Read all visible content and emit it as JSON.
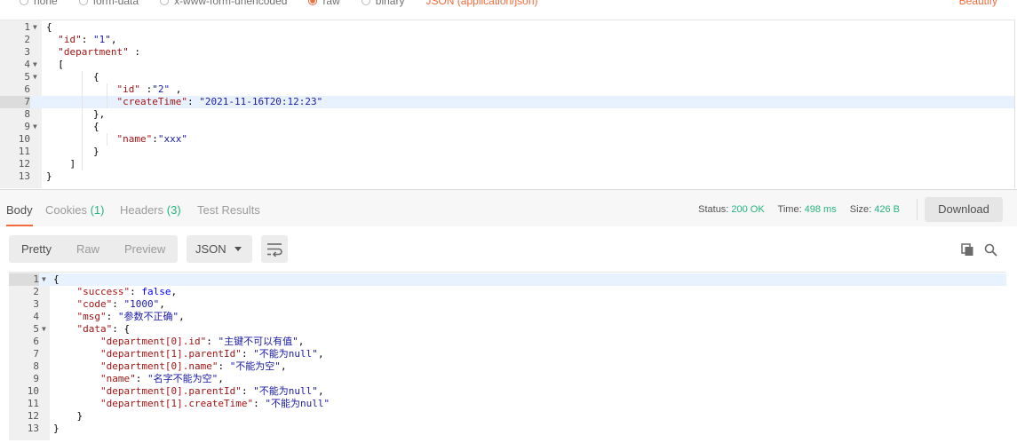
{
  "body_type_options": [
    {
      "label": "none",
      "selected": false
    },
    {
      "label": "form-data",
      "selected": false
    },
    {
      "label": "x-www-form-urlencoded",
      "selected": false
    },
    {
      "label": "raw",
      "selected": true
    },
    {
      "label": "binary",
      "selected": false
    }
  ],
  "raw_type_label": "JSON (application/json)",
  "beautify_label": "Beautify",
  "request_editor": {
    "active_line": 7,
    "lines": [
      {
        "n": "1",
        "fold": true,
        "text": "{"
      },
      {
        "n": "2",
        "fold": false,
        "text": "  \"id\": \"1\","
      },
      {
        "n": "3",
        "fold": false,
        "text": "  \"department\" :"
      },
      {
        "n": "4",
        "fold": true,
        "text": "  ["
      },
      {
        "n": "5",
        "fold": true,
        "text": "        {"
      },
      {
        "n": "6",
        "fold": false,
        "text": "            \"id\" :\"2\" ,"
      },
      {
        "n": "7",
        "fold": false,
        "text": "            \"createTime\": \"2021-11-16T20:12:23\""
      },
      {
        "n": "8",
        "fold": false,
        "text": "        },"
      },
      {
        "n": "9",
        "fold": true,
        "text": "        {"
      },
      {
        "n": "10",
        "fold": false,
        "text": "            \"name\":\"xxx\""
      },
      {
        "n": "11",
        "fold": false,
        "text": "        }"
      },
      {
        "n": "12",
        "fold": false,
        "text": "    ]"
      },
      {
        "n": "13",
        "fold": false,
        "text": "}"
      }
    ]
  },
  "response_tabs": [
    {
      "label": "Body",
      "count": "",
      "active": true
    },
    {
      "label": "Cookies",
      "count": "(1)",
      "active": false
    },
    {
      "label": "Headers",
      "count": "(3)",
      "active": false
    },
    {
      "label": "Test Results",
      "count": "",
      "active": false
    }
  ],
  "status": {
    "status_label": "Status:",
    "status_value": "200 OK",
    "time_label": "Time:",
    "time_value": "498 ms",
    "size_label": "Size:",
    "size_value": "426 B"
  },
  "download_label": "Download",
  "view_modes": [
    {
      "label": "Pretty",
      "active": true
    },
    {
      "label": "Raw",
      "active": false
    },
    {
      "label": "Preview",
      "active": false
    }
  ],
  "format_select": "JSON",
  "colors": {
    "accent": "#f26b3a",
    "success": "#26b47f",
    "key": "#a31515",
    "string": "#1a1aa6",
    "keyword": "#0000ff"
  },
  "icons": [
    "wrap-lines-icon",
    "copy-icon",
    "search-icon",
    "chevron-down-icon",
    "fold-arrow-icon"
  ],
  "response_editor": {
    "active_line": 1,
    "lines": [
      {
        "n": "1",
        "fold": true,
        "text": "{"
      },
      {
        "n": "2",
        "fold": false,
        "text": "    \"success\": false,"
      },
      {
        "n": "3",
        "fold": false,
        "text": "    \"code\": \"1000\","
      },
      {
        "n": "4",
        "fold": false,
        "text": "    \"msg\": \"参数不正确\","
      },
      {
        "n": "5",
        "fold": true,
        "text": "    \"data\": {"
      },
      {
        "n": "6",
        "fold": false,
        "text": "        \"department[0].id\": \"主键不可以有值\","
      },
      {
        "n": "7",
        "fold": false,
        "text": "        \"department[1].parentId\": \"不能为null\","
      },
      {
        "n": "8",
        "fold": false,
        "text": "        \"department[0].name\": \"不能为空\","
      },
      {
        "n": "9",
        "fold": false,
        "text": "        \"name\": \"名字不能为空\","
      },
      {
        "n": "10",
        "fold": false,
        "text": "        \"department[0].parentId\": \"不能为null\","
      },
      {
        "n": "11",
        "fold": false,
        "text": "        \"department[1].createTime\": \"不能为null\""
      },
      {
        "n": "12",
        "fold": false,
        "text": "    }"
      },
      {
        "n": "13",
        "fold": false,
        "text": "}"
      }
    ]
  }
}
